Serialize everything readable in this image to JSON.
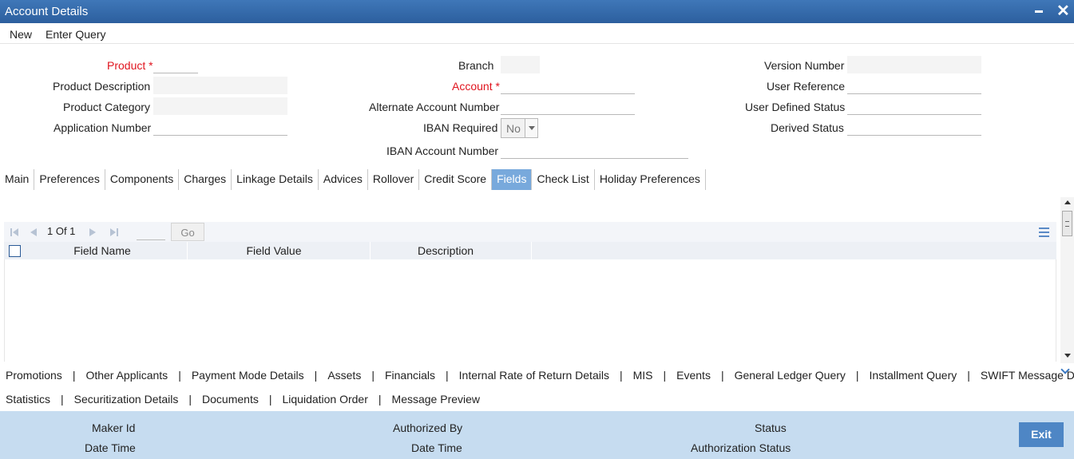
{
  "window": {
    "title": "Account Details"
  },
  "menu": {
    "new": "New",
    "enter_query": "Enter Query"
  },
  "form": {
    "product": "Product",
    "product_description": "Product Description",
    "product_category": "Product Category",
    "application_number": "Application Number",
    "branch": "Branch",
    "account": "Account",
    "alternate_account_number": "Alternate Account Number",
    "iban_required": "IBAN Required",
    "iban_required_value": "No",
    "iban_account_number": "IBAN Account Number",
    "version_number": "Version Number",
    "user_reference": "User Reference",
    "user_defined_status": "User Defined Status",
    "derived_status": "Derived Status",
    "required_marker": "*"
  },
  "tabs": [
    "Main",
    "Preferences",
    "Components",
    "Charges",
    "Linkage Details",
    "Advices",
    "Rollover",
    "Credit Score",
    "Fields",
    "Check List",
    "Holiday Preferences"
  ],
  "active_tab": "Fields",
  "grid": {
    "page_info": "1 Of 1",
    "go_label": "Go",
    "columns": [
      "Field Name",
      "Field Value",
      "Description"
    ],
    "rows": []
  },
  "sublinks": {
    "row1": [
      "Promotions",
      "Other Applicants",
      "Payment Mode Details",
      "Assets",
      "Financials",
      "Internal Rate of Return Details",
      "MIS",
      "Events",
      "General Ledger Query",
      "Installment Query",
      "SWIFT Message Details"
    ],
    "row2": [
      "Statistics",
      "Securitization Details",
      "Documents",
      "Liquidation Order",
      "Message Preview"
    ],
    "separator": "|"
  },
  "footer": {
    "maker_id": "Maker Id",
    "date_time": "Date Time",
    "authorized_by": "Authorized By",
    "status": "Status",
    "authorization_status": "Authorization Status",
    "exit_label": "Exit"
  },
  "colors": {
    "titlebar": "#2c5f9e",
    "active_tab": "#78a9dc",
    "footer": "#c6dcf0",
    "required": "#e0141e",
    "exit_button": "#4e86c5"
  }
}
